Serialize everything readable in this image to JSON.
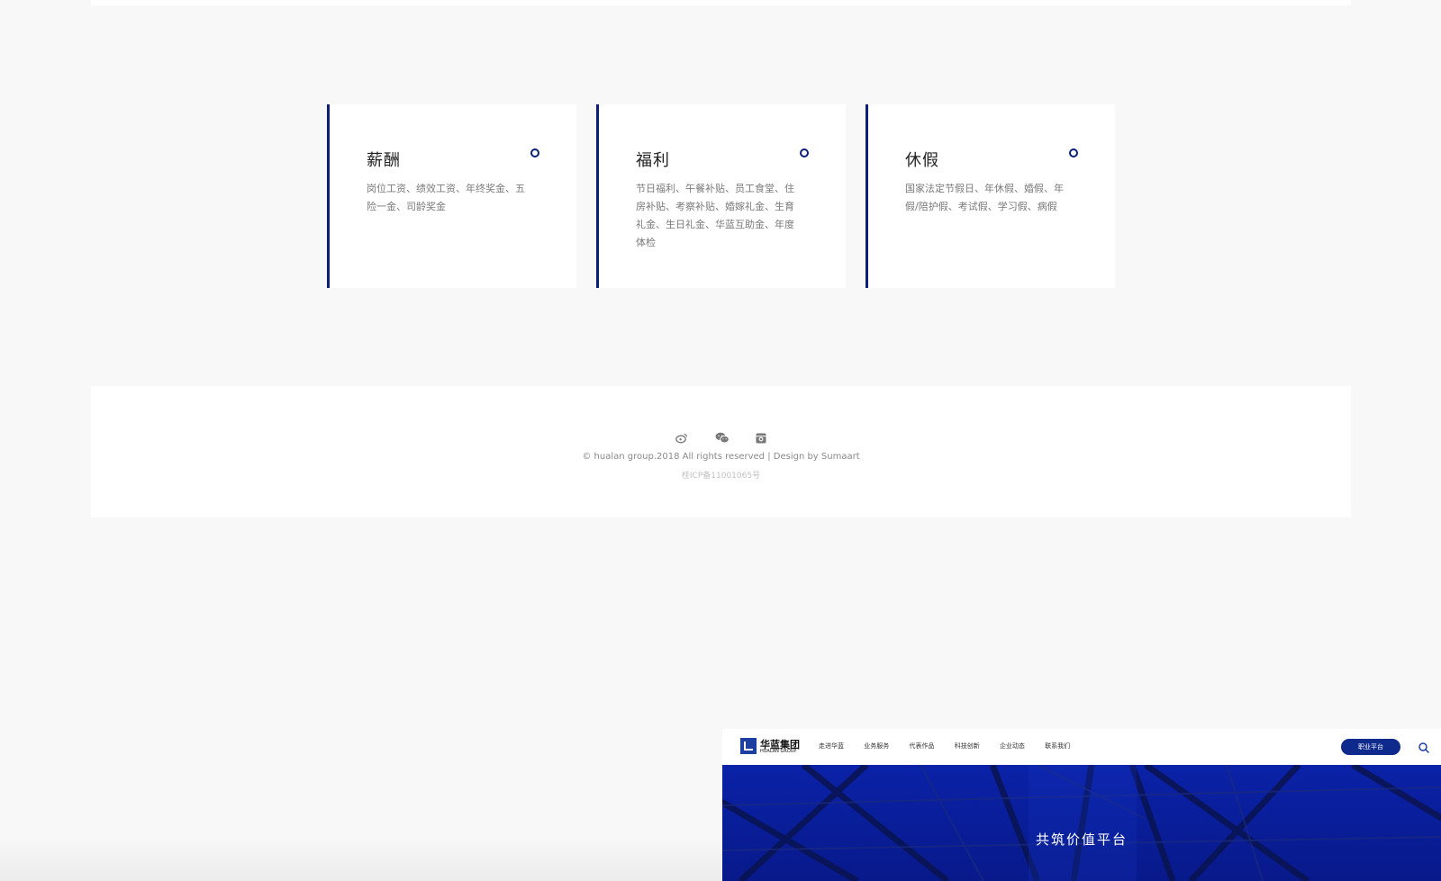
{
  "benefits": [
    {
      "title": "薪酬",
      "desc": "岗位工资、绩效工资、年终奖金、五险一金、司龄奖金"
    },
    {
      "title": "福利",
      "desc": "节日福利、午餐补贴、员工食堂、住房补贴、考察补贴、婚嫁礼金、生育礼金、生日礼金、华蓝互助金、年度体检"
    },
    {
      "title": "休假",
      "desc": "国家法定节假日、年休假、婚假、年假/陪护假、考试假、学习假、病假"
    }
  ],
  "footer": {
    "social_icons": [
      "weibo-icon",
      "wechat-icon",
      "instagram-icon"
    ],
    "copyright": "© hualan group.2018 All rights reserved | Design by Sumaart",
    "icp": "桂ICP备11001065号"
  },
  "preview": {
    "logo_cn": "华蓝集团",
    "logo_en": "HUALAN GROUP",
    "nav": [
      "走进华蓝",
      "业务服务",
      "代表作品",
      "科技创新",
      "企业动态",
      "联系我们"
    ],
    "platform_button": "职业平台",
    "hero_title": "共筑价值平台"
  },
  "colors": {
    "accent": "#0b1f79",
    "hero_blue": "#0a22a8",
    "page_bg": "#f8f8f8"
  }
}
